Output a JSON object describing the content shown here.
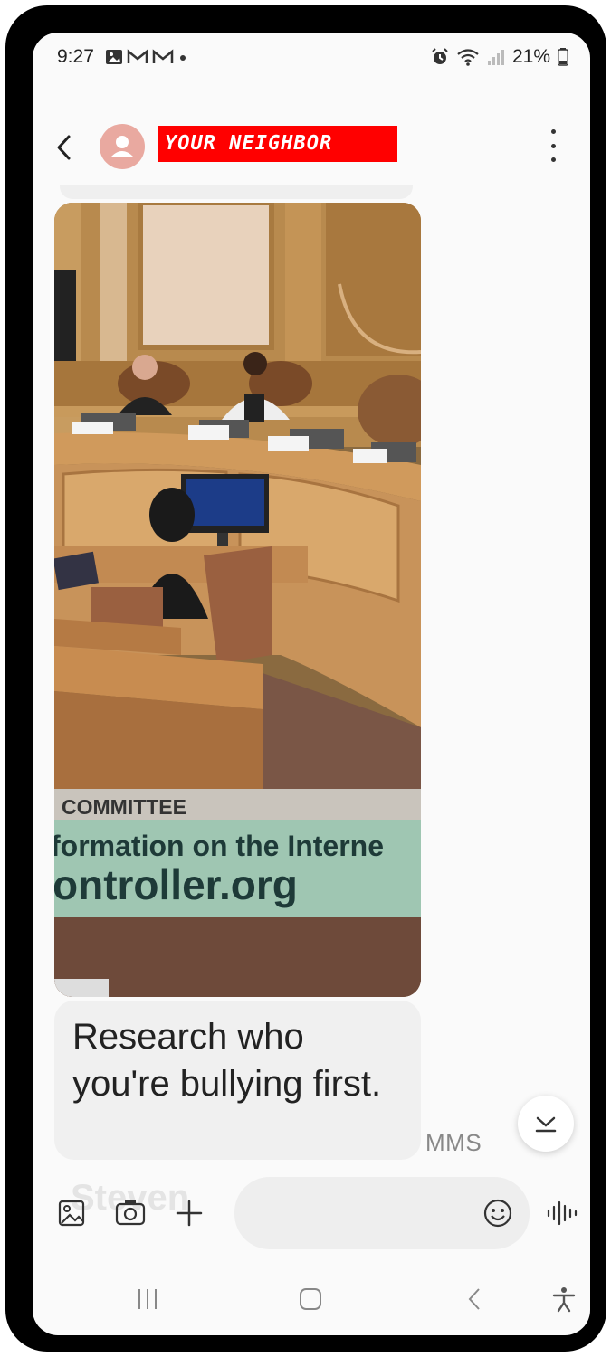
{
  "status_bar": {
    "time": "9:27",
    "battery": "21%"
  },
  "header": {
    "contact_name": "YOUR NEIGHBOR",
    "back_icon": "chevron-left-icon",
    "menu_icon": "more-vertical-icon"
  },
  "image_message": {
    "overlay_line1": "COMMITTEE",
    "overlay_line2": "formation on the Interne",
    "overlay_line3": "ontroller.org"
  },
  "text_message": {
    "text": "Research who you're bullying first.",
    "type_label": "MMS"
  },
  "faded_sender": "Steven",
  "input": {
    "placeholder": ""
  },
  "colors": {
    "accent_red": "#ff0000",
    "avatar": "#e9a9a0",
    "bubble": "#f0f0f0"
  }
}
